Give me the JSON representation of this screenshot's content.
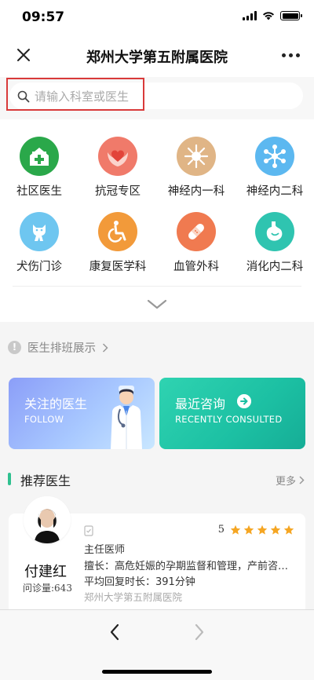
{
  "status_bar": {
    "time": "09:57"
  },
  "nav": {
    "title": "郑州大学第五附属医院"
  },
  "search": {
    "placeholder": "请输入科室或医生"
  },
  "departments": [
    {
      "label": "社区医生",
      "icon": "community-hospital-icon",
      "color": "#2aa84a"
    },
    {
      "label": "抗冠专区",
      "icon": "heart-hands-icon",
      "color": "#f07a6a"
    },
    {
      "label": "神经内一科",
      "icon": "neuron-icon",
      "color": "#e0b586"
    },
    {
      "label": "神经内二科",
      "icon": "network-icon",
      "color": "#5cb8f0"
    },
    {
      "label": "犬伤门诊",
      "icon": "dog-icon",
      "color": "#6ec6f0"
    },
    {
      "label": "康复医学科",
      "icon": "wheelchair-icon",
      "color": "#f29a3a"
    },
    {
      "label": "血管外科",
      "icon": "bandage-icon",
      "color": "#f07a50"
    },
    {
      "label": "消化内二科",
      "icon": "stomach-icon",
      "color": "#2fc4b0"
    }
  ],
  "schedule": {
    "label": "医生排班展示"
  },
  "cards": {
    "follow": {
      "title": "关注的医生",
      "subtitle": "FOLLOW"
    },
    "recent": {
      "title": "最近咨询",
      "subtitle": "RECENTLY CONSULTED"
    }
  },
  "recommended": {
    "title": "推荐医生",
    "more": "更多",
    "doctor": {
      "name": "付建红",
      "consults": "问诊量:643",
      "rating": "5",
      "stars": 5,
      "title": "主任医师",
      "specialty": "擅长：高危妊娠的孕期监督和管理，产前咨询及产前诊断",
      "reply": "平均回复时长：391分钟",
      "hospital": "郑州大学第五附属医院"
    }
  },
  "colors": {
    "accent_green": "#2fc08f",
    "star": "#f5a623",
    "highlight_border": "#d93a3a"
  }
}
